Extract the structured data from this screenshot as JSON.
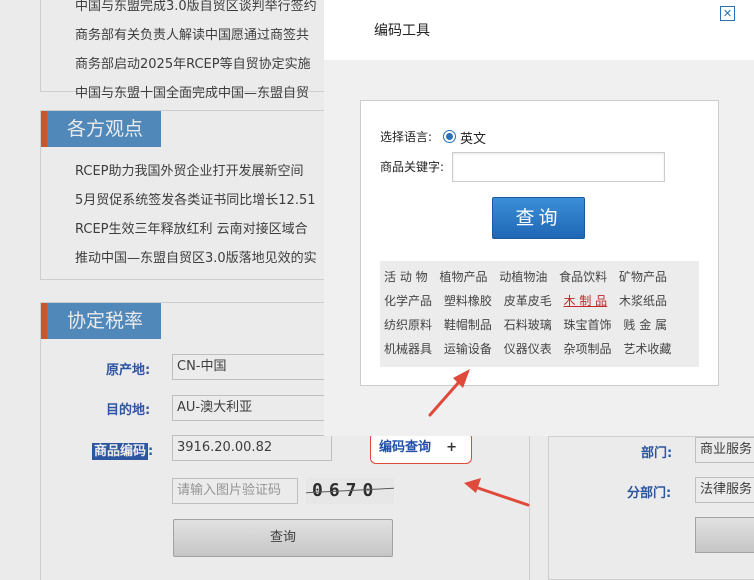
{
  "news_top": [
    "中国与东盟完成3.0版自贸区谈判举行签约",
    "商务部有关负责人解读中国愿通过商签共",
    "商务部启动2025年RCEP等自贸协定实施",
    "中国与东盟十国全面完成中国—东盟自贸"
  ],
  "views": {
    "title": "各方观点",
    "items": [
      "RCEP助力我国外贸企业打开发展新空间",
      "5月贸促系统签发各类证书同比增长12.51",
      "RCEP生效三年释放红利 云南对接区域合",
      "推动中国—东盟自贸区3.0版落地见效的实"
    ]
  },
  "tariff": {
    "title": "协定税率",
    "origin_label": "原产地:",
    "origin_value": "CN-中国",
    "dest_label": "目的地:",
    "dest_value": "AU-澳大利亚",
    "code_label": "商品编码",
    "code_colon": ":",
    "code_value": "3916.20.00.82",
    "captcha_placeholder": "请输入图片验证码",
    "captcha_text": "0670",
    "query_button": "查询",
    "code_lookup_link": "编码查询",
    "code_lookup_plus": "+"
  },
  "right_panel": {
    "dept_label": "部门:",
    "dept_value": "商业服务",
    "subdept_label": "分部门:",
    "subdept_value": "法律服务"
  },
  "modal": {
    "title": "编码工具",
    "close_icon": "close-icon",
    "lang_label": "选择语言:",
    "lang_value": "英文",
    "keyword_label": "商品关键字:",
    "keyword_value": "",
    "search_button": "查询",
    "categories": [
      "活 动 物",
      "植物产品",
      "动植物油",
      "食品饮料",
      "矿物产品",
      "化学产品",
      "塑料橡胶",
      "皮革皮毛",
      "木 制 品",
      "木浆纸品",
      "纺织原料",
      "鞋帽制品",
      "石料玻璃",
      "珠宝首饰",
      "贱 金 属",
      "机械器具",
      "运输设备",
      "仪器仪表",
      "杂项制品",
      "艺术收藏"
    ],
    "active_category": "木 制 品"
  },
  "colors": {
    "title_bar": "#4a8bc6",
    "label_blue": "#2050a8",
    "accent_red": "#e04a3a",
    "button_blue": "#1f67b5"
  }
}
